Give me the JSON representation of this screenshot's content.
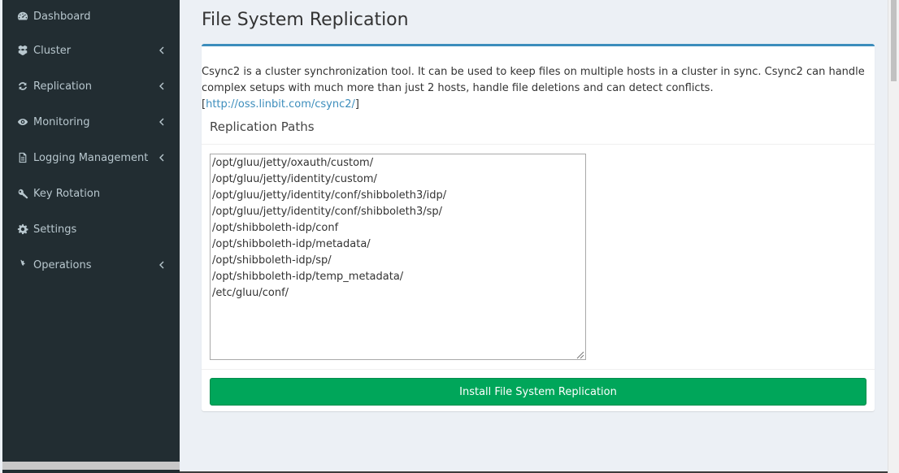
{
  "sidebar": {
    "items": [
      {
        "label": "Dashboard",
        "icon": "dashboard-icon",
        "has_submenu": false
      },
      {
        "label": "Cluster",
        "icon": "cubes-icon",
        "has_submenu": true
      },
      {
        "label": "Replication",
        "icon": "refresh-icon",
        "has_submenu": true
      },
      {
        "label": "Monitoring",
        "icon": "eye-icon",
        "has_submenu": true
      },
      {
        "label": "Logging Management",
        "icon": "file-text-icon",
        "has_submenu": true
      },
      {
        "label": "Key Rotation",
        "icon": "key-icon",
        "has_submenu": false
      },
      {
        "label": "Settings",
        "icon": "gear-icon",
        "has_submenu": false
      },
      {
        "label": "Operations",
        "icon": "gears-icon",
        "has_submenu": true
      }
    ]
  },
  "page": {
    "title": "File System Replication",
    "description": "Csync2 is a cluster synchronization tool. It can be used to keep files on multiple hosts in a cluster in sync. Csync2 can handle complex setups with much more than just 2 hosts, handle file deletions and can detect conflicts.",
    "link_text": "http://oss.linbit.com/csync2/",
    "link_open": "[",
    "link_close": "]",
    "panel_title": "Replication Paths",
    "paths": [
      "/opt/gluu/jetty/oxauth/custom/",
      "/opt/gluu/jetty/identity/custom/",
      "/opt/gluu/jetty/identity/conf/shibboleth3/idp/",
      "/opt/gluu/jetty/identity/conf/shibboleth3/sp/",
      "/opt/shibboleth-idp/conf",
      "/opt/shibboleth-idp/metadata/",
      "/opt/shibboleth-idp/sp/",
      "/opt/shibboleth-idp/temp_metadata/",
      "/etc/gluu/conf/"
    ],
    "install_button": "Install File System Replication"
  },
  "colors": {
    "sidebar_bg": "#222d32",
    "sidebar_text": "#b8c7ce",
    "box_accent": "#3c8dbc",
    "button_green": "#00a65a",
    "link": "#3c8dbc"
  }
}
